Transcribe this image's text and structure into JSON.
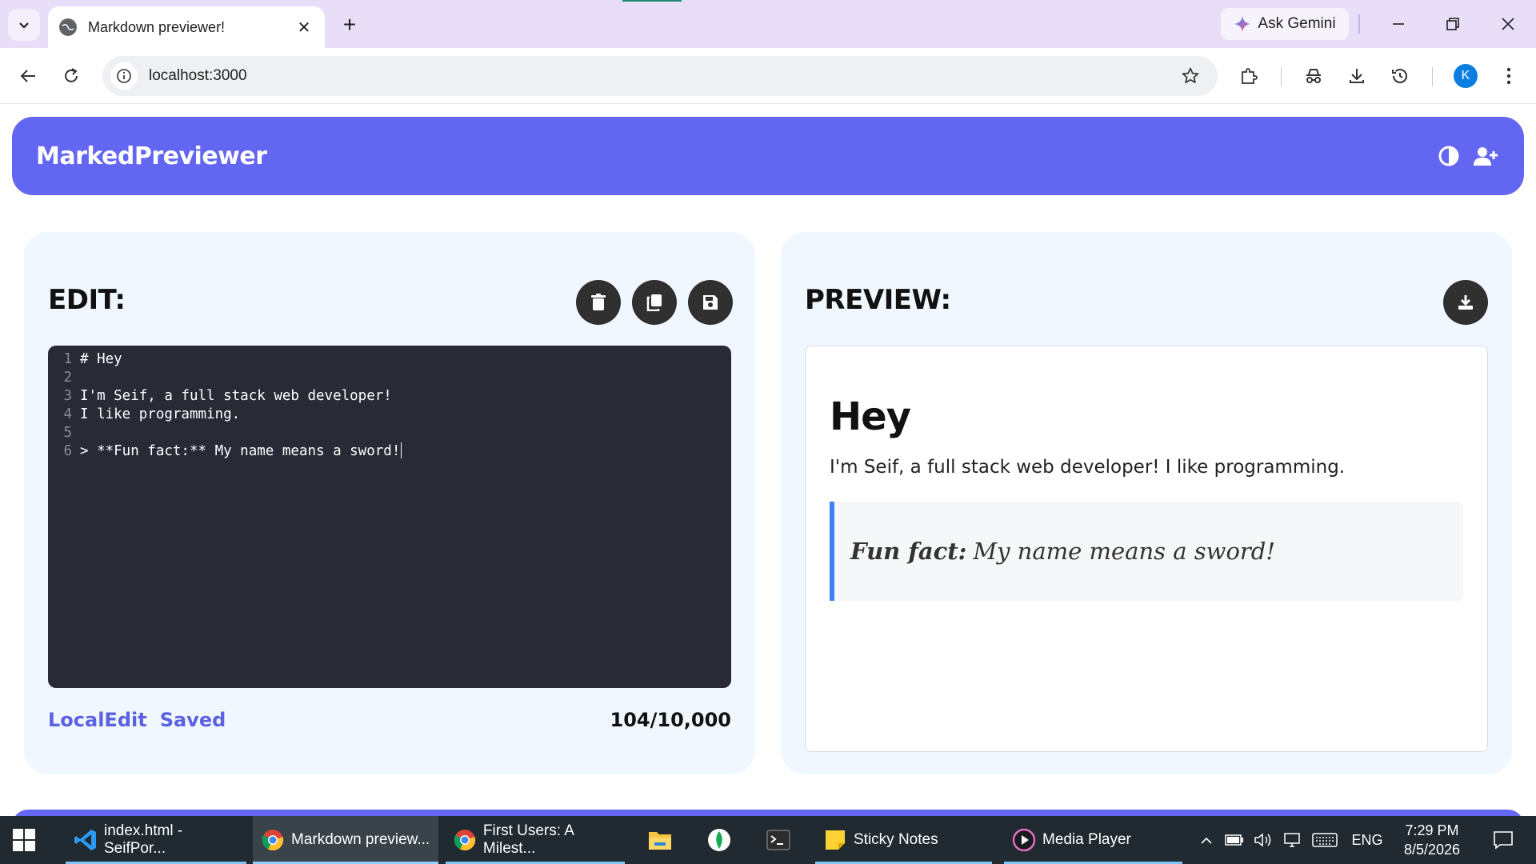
{
  "browser": {
    "tab_title": "Markdown previewer!",
    "gemini_label": "Ask Gemini",
    "url": "localhost:3000",
    "profile_initial": "K"
  },
  "app": {
    "logo": "MarkedPreviewer",
    "edit_title": "EDIT:",
    "preview_title": "PREVIEW:",
    "editor_lines": [
      {
        "num": "1",
        "text": "# Hey"
      },
      {
        "num": "2",
        "text": ""
      },
      {
        "num": "3",
        "text": "I'm Seif, a full stack web developer!"
      },
      {
        "num": "4",
        "text": "I like programming."
      },
      {
        "num": "5",
        "text": ""
      },
      {
        "num": "6",
        "text": "> **Fun fact:** My name means a sword!"
      }
    ],
    "status_local": "LocalEdit",
    "status_saved": "Saved",
    "char_count": "104/10,000",
    "preview": {
      "heading": "Hey",
      "paragraph": "I'm Seif, a full stack web developer! I like programming.",
      "quote_bold": "Fun fact:",
      "quote_text": "My name means a sword!"
    },
    "accent_color": "#6366f1"
  },
  "taskbar": {
    "items": [
      {
        "label": "index.html - SeifPor...",
        "icon": "vscode-icon"
      },
      {
        "label": "Markdown preview...",
        "icon": "chrome-icon"
      },
      {
        "label": "First Users: A Milest...",
        "icon": "chrome-icon"
      },
      {
        "label": "",
        "icon": "file-explorer-icon"
      },
      {
        "label": "",
        "icon": "mongodb-icon"
      },
      {
        "label": "",
        "icon": "terminal-icon"
      },
      {
        "label": "Sticky Notes",
        "icon": "sticky-notes-icon"
      },
      {
        "label": "Media Player",
        "icon": "media-player-icon"
      }
    ],
    "language": "ENG",
    "time": "7:29 PM",
    "date": "8/5/2026"
  }
}
